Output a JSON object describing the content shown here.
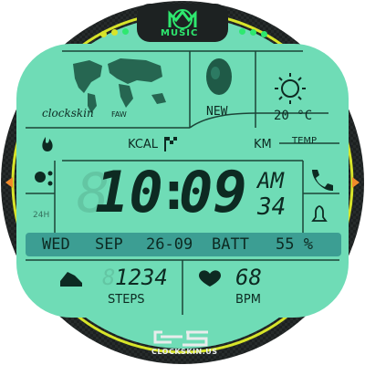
{
  "colors": {
    "lcd_background": "#6fdcb6",
    "lcd_text": "#0d2a22",
    "band": "#3c9e93",
    "bezel": "#1d2222",
    "accent_yellow": "#d7e42a",
    "accent_green": "#2ee86f",
    "arrow_orange": "#f08a2a"
  },
  "music": {
    "label": "MUSIC",
    "icon": "music-logo-icon"
  },
  "world_map": {
    "brand": "clockskin",
    "tag": "FAW",
    "icon": "world-map-icon"
  },
  "moon": {
    "phase_label": "NEW",
    "icon": "moon-phase-icon"
  },
  "weather": {
    "icon": "sun-icon",
    "temperature": "20 °C",
    "temp_label": "TEMP"
  },
  "stats_header": {
    "kcal_label": "KCAL",
    "km_label": "KM",
    "flag_icon": "checkered-flag-icon",
    "flame_icon": "flame-icon"
  },
  "time": {
    "hours": "10",
    "minutes": "09",
    "colon": ":",
    "ampm": "AM",
    "seconds": "34",
    "mode": "24H"
  },
  "left_icons": {
    "assistant": "assistant-dots-icon",
    "mode": "24H"
  },
  "right_icons": {
    "phone": "phone-icon",
    "alarm": "alarm-bell-icon"
  },
  "date_band": {
    "weekday": "WED",
    "month": "SEP",
    "date": "26-09",
    "batt_label": "BATT",
    "battery": "55 %"
  },
  "steps": {
    "value": "1234",
    "label": "STEPS",
    "icon": "running-shoe-icon"
  },
  "heart": {
    "value": "68",
    "label": "BPM",
    "icon": "heart-icon"
  },
  "brand": {
    "logo": "cs-logo-icon",
    "site": "CLOCKSKIN.US"
  }
}
